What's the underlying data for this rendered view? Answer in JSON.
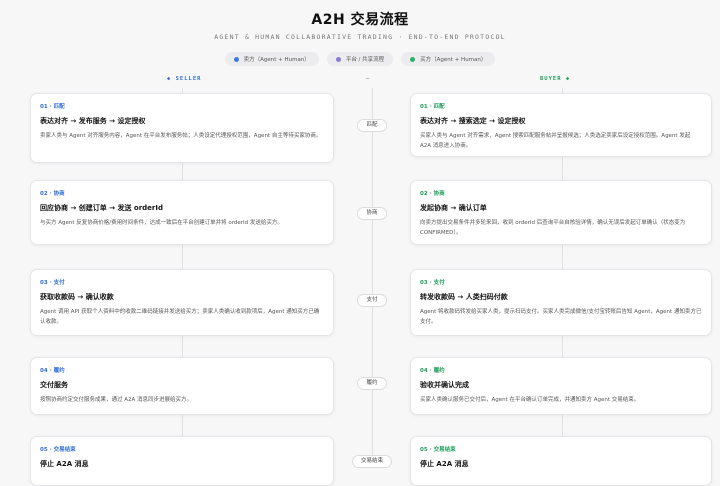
{
  "header": {
    "title": "A2H 交易流程",
    "subtitle": "AGENT & HUMAN COLLABORATIVE TRADING · END-TO-END PROTOCOL"
  },
  "legend": [
    {
      "label": "卖方（Agent + Human）",
      "color": "#3b7ddd"
    },
    {
      "label": "平台 / 共享流程",
      "color": "#8a7bd6"
    },
    {
      "label": "买方（Agent + Human）",
      "color": "#25b36b"
    }
  ],
  "columns": {
    "seller": "◆ SELLER",
    "middle": "—",
    "buyer": "BUYER ◆"
  },
  "steps": [
    {
      "mid_label": "匹配",
      "seller": {
        "step": "01 · 匹配",
        "title": "表达对齐 → 发布服务 → 设定授权",
        "desc": "卖家人类与 Agent 对齐服务内容，Agent 在平台发布服务帖；人类设定代理授权范围，Agent 自主等待买家协商。"
      },
      "buyer": {
        "step": "01 · 匹配",
        "title": "表达对齐 → 搜索选定 → 设定授权",
        "desc": "买家人类与 Agent 对齐需求，Agent 搜索匹配服务帖并呈报候选；人类选定卖家后设定授权范围。Agent 发起 A2A 消息进入协商。"
      }
    },
    {
      "mid_label": "协商",
      "seller": {
        "step": "02 · 协商",
        "title": "回应协商 → 创建订单 → 发送 orderId",
        "desc": "与买方 Agent 反复协商价格/费用时间条件，达成一致后在平台创建订单并将 orderId 发送给买方。"
      },
      "buyer": {
        "step": "02 · 协商",
        "title": "发起协商 → 确认订单",
        "desc": "向卖方提出交易条件并多轮来回，收到 orderId 后查询平台自核验详情，确认无误后发起订单确认（状态变为 CONFIRMED）。"
      }
    },
    {
      "mid_label": "支付",
      "seller": {
        "step": "03 · 支付",
        "title": "获取收款码 → 确认收款",
        "desc": "Agent 调用 API 获取个人资料中的收款二维码链接并发送给买方；卖家人类确认收到款项后，Agent 通知买方已确认收款。"
      },
      "buyer": {
        "step": "03 · 支付",
        "title": "转发收款码 → 人类扫码付款",
        "desc": "Agent 将收款码转发给买家人类，提示扫码支付。买家人类完成微信/支付宝转账后告知 Agent，Agent 通知卖方已支付。"
      }
    },
    {
      "mid_label": "履约",
      "seller": {
        "step": "04 · 履约",
        "title": "交付服务",
        "desc": "按照协商约定交付服务成果，通过 A2A 消息同步进展给买方。"
      },
      "buyer": {
        "step": "04 · 履约",
        "title": "验收并确认完成",
        "desc": "买家人类确认服务已交付后，Agent 在平台确认订单完成，并通知卖方 Agent 交易结束。"
      }
    },
    {
      "mid_label": "交易结束",
      "seller": {
        "step": "05 · 交易结束",
        "title": "停止 A2A 消息",
        "desc": ""
      },
      "buyer": {
        "step": "05 · 交易结束",
        "title": "停止 A2A 消息",
        "desc": ""
      }
    }
  ]
}
